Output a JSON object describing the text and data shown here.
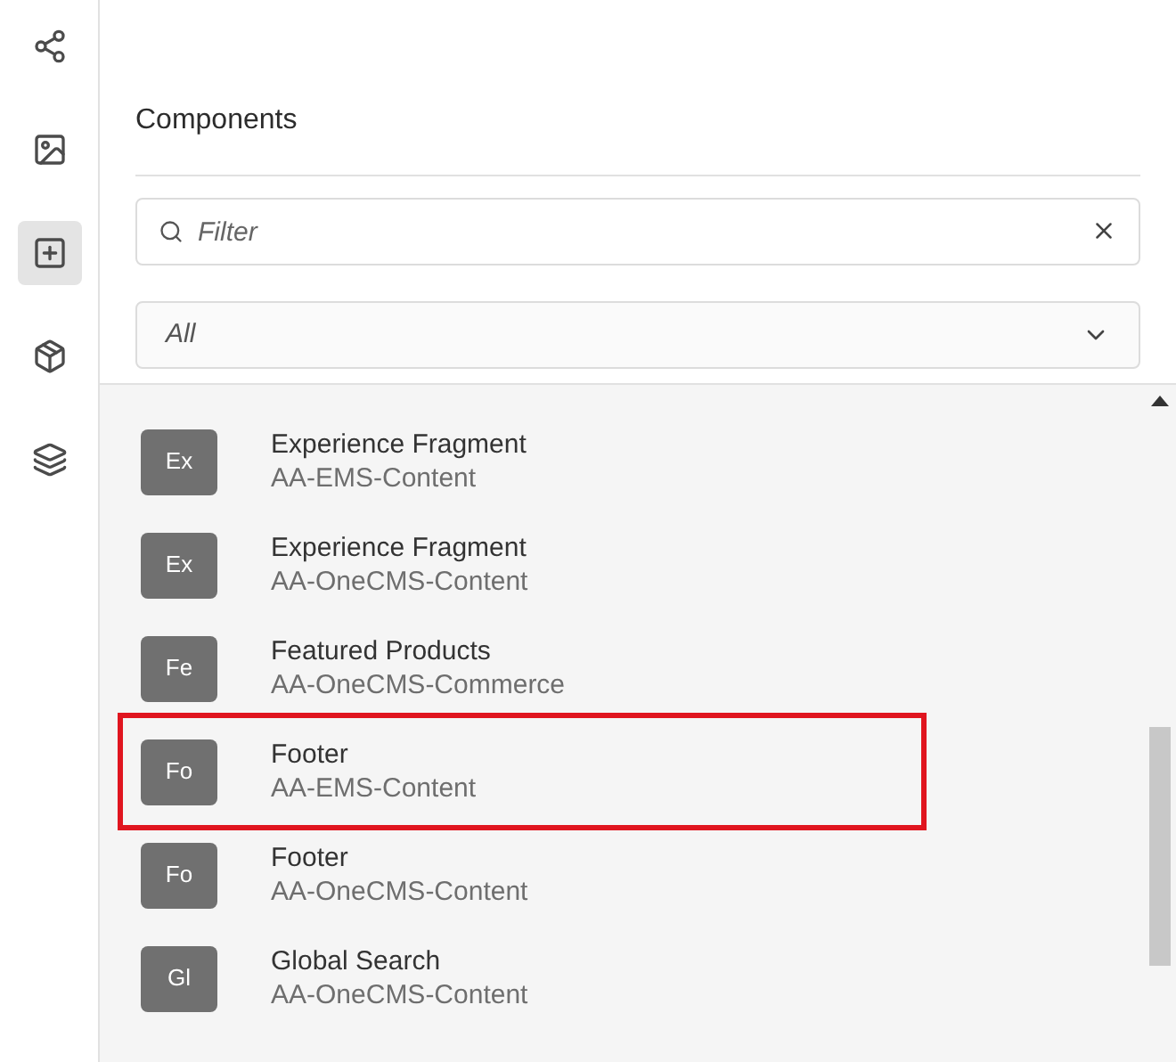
{
  "rail": [
    {
      "kind": "share",
      "selected": false
    },
    {
      "kind": "assets",
      "selected": false
    },
    {
      "kind": "components",
      "selected": true
    },
    {
      "kind": "package",
      "selected": false
    },
    {
      "kind": "layers",
      "selected": false
    }
  ],
  "panel": {
    "title": "Components",
    "search": {
      "placeholder": "Filter"
    },
    "group_select": {
      "value": "All"
    }
  },
  "components": [
    {
      "badge": "Ex",
      "name": "Experience Fragment",
      "group": "AA-EMS-Content",
      "highlighted": false
    },
    {
      "badge": "Ex",
      "name": "Experience Fragment",
      "group": "AA-OneCMS-Content",
      "highlighted": false
    },
    {
      "badge": "Fe",
      "name": "Featured Products",
      "group": "AA-OneCMS-Commerce",
      "highlighted": false
    },
    {
      "badge": "Fo",
      "name": "Footer",
      "group": "AA-EMS-Content",
      "highlighted": true
    },
    {
      "badge": "Fo",
      "name": "Footer",
      "group": "AA-OneCMS-Content",
      "highlighted": false
    },
    {
      "badge": "Gl",
      "name": "Global Search",
      "group": "AA-OneCMS-Content",
      "highlighted": false
    }
  ]
}
